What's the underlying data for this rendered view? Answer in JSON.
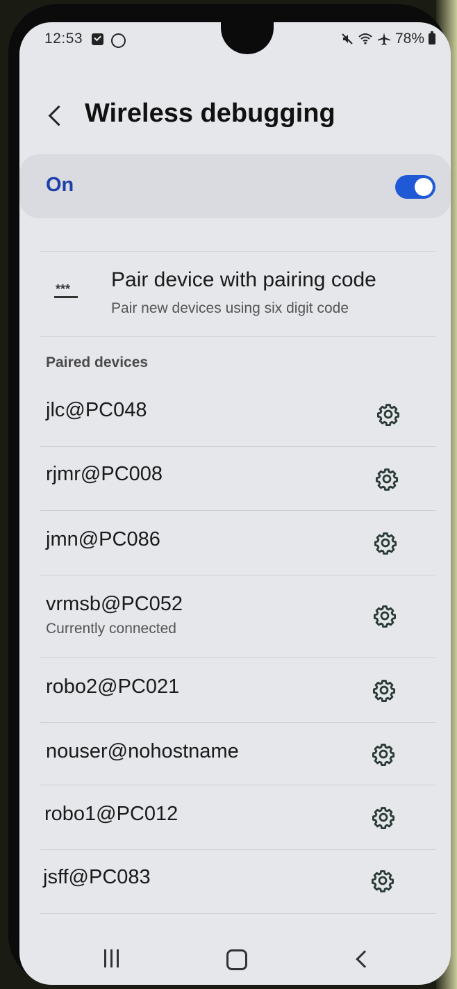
{
  "status_bar": {
    "time": "12:53",
    "battery": "78%",
    "icons": [
      "checkbox-notification-icon",
      "circle-notification-icon",
      "mute-icon",
      "wifi-icon",
      "airplane-icon",
      "battery-icon"
    ]
  },
  "header": {
    "title": "Wireless debugging",
    "back_icon": "chevron-left-icon"
  },
  "master_switch": {
    "label": "On",
    "state": "on",
    "accent": "#1f59d6"
  },
  "pair_option": {
    "icon": "pin-code-icon",
    "title": "Pair device with pairing code",
    "subtitle": "Pair new devices using six digit code"
  },
  "paired_section": {
    "label": "Paired devices",
    "devices": [
      {
        "name": "jlc@PC048",
        "status": ""
      },
      {
        "name": "rjmr@PC008",
        "status": ""
      },
      {
        "name": "jmn@PC086",
        "status": ""
      },
      {
        "name": "vrmsb@PC052",
        "status": "Currently connected"
      },
      {
        "name": "robo2@PC021",
        "status": ""
      },
      {
        "name": "nouser@nohostname",
        "status": ""
      },
      {
        "name": "robo1@PC012",
        "status": ""
      },
      {
        "name": "jsff@PC083",
        "status": ""
      }
    ]
  },
  "nav_bar": {
    "icons": [
      "recent-apps-icon",
      "home-icon",
      "back-icon"
    ]
  }
}
